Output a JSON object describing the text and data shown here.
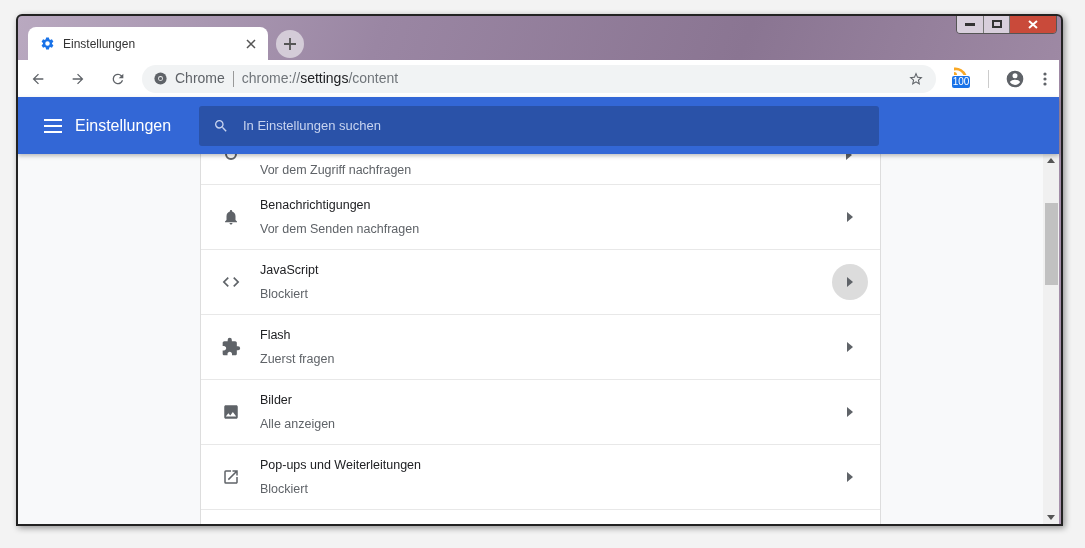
{
  "tab": {
    "title": "Einstellungen"
  },
  "address_bar": {
    "site_label": "Chrome",
    "url_prefix": "chrome://",
    "url_host": "settings",
    "url_path": "/content"
  },
  "extension": {
    "badge": "100"
  },
  "header": {
    "title": "Einstellungen",
    "search": {
      "placeholder": "In Einstellungen suchen"
    }
  },
  "partial_row": {
    "subtitle": "Vor dem Zugriff nachfragen"
  },
  "rows": [
    {
      "kind": "bell",
      "title": "Benachrichtigungen",
      "subtitle": "Vor dem Senden nachfragen",
      "hovered": false
    },
    {
      "kind": "code",
      "title": "JavaScript",
      "subtitle": "Blockiert",
      "hovered": true
    },
    {
      "kind": "puzzle",
      "title": "Flash",
      "subtitle": "Zuerst fragen",
      "hovered": false
    },
    {
      "kind": "image",
      "title": "Bilder",
      "subtitle": "Alle anzeigen",
      "hovered": false
    },
    {
      "kind": "launch",
      "title": "Pop-ups und Weiterleitungen",
      "subtitle": "Blockiert",
      "hovered": false
    }
  ]
}
